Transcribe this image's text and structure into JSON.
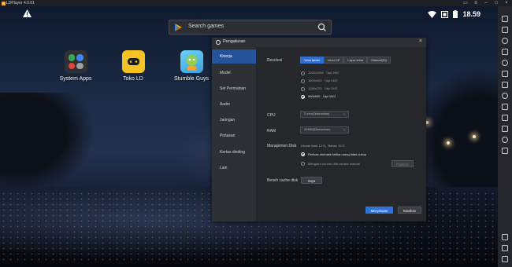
{
  "window": {
    "title": "LDPlayer 4.0.61"
  },
  "statusbar": {
    "time": "18.59"
  },
  "search": {
    "placeholder": "Search games"
  },
  "apps": [
    {
      "label": "System Apps"
    },
    {
      "label": "Toko LD"
    },
    {
      "label": "Stumble Guys"
    }
  ],
  "dialog": {
    "title": "Pengaturan",
    "sidebar": [
      {
        "label": "Kinerja",
        "active": true
      },
      {
        "label": "Model"
      },
      {
        "label": "Set Permainan"
      },
      {
        "label": "Audio"
      },
      {
        "label": "Jaringan"
      },
      {
        "label": "Pintasan"
      },
      {
        "label": "Kertas dinding"
      },
      {
        "label": "Lain"
      }
    ],
    "resolution": {
      "label": "Resolusi",
      "tabs": [
        "Versi tablet",
        "Versi HP",
        "Layar lebar",
        "Manual(Kt)"
      ],
      "options": [
        {
          "label": "1920x1080 （dpi 280）"
        },
        {
          "label": "1600x900 （dpi 240）"
        },
        {
          "label": "1280x720 （dpi 240）"
        },
        {
          "label": "960x540 （dpi 160）",
          "selected": true
        }
      ]
    },
    "cpu": {
      "label": "CPU",
      "value": "2 core(Disarankan)"
    },
    "ram": {
      "label": "RAM",
      "value": "2048M(Disarankan)"
    },
    "disk": {
      "label": "Manajemen Disk",
      "info": "Ukuran total: 12 G，Bebas: 10 G",
      "options": [
        {
          "label": "Perluas otomatis ketika ruang tidak cukup",
          "selected": true
        },
        {
          "label": "Mengatur ukuran disk secara manual"
        }
      ],
      "confirm_label": "Pastikan"
    },
    "cache": {
      "label": "Bersih cache disk",
      "button": "Saya"
    },
    "footer": {
      "save": "Menyimpan",
      "cancel": "Batalkan"
    }
  },
  "colors": {
    "accent": "#2f73d9",
    "dialog_bg": "#25272b",
    "sidebar_active": "#24539c"
  }
}
